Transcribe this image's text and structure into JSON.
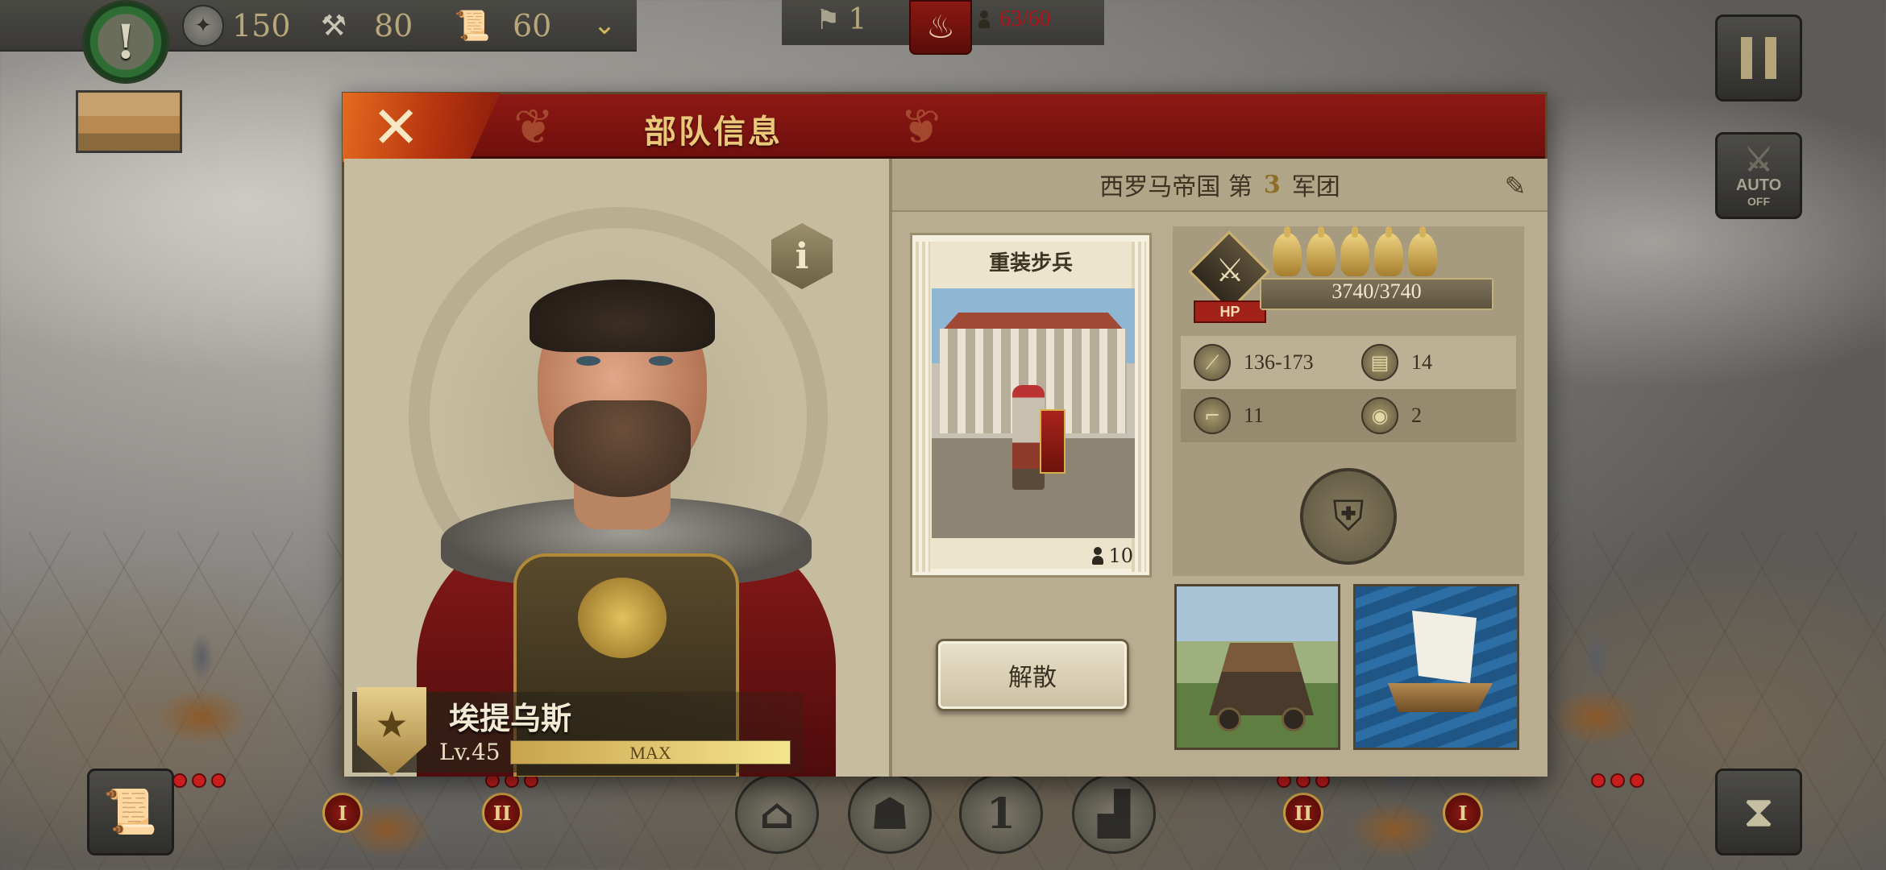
{
  "hud": {
    "alert_mark": "!",
    "resources": [
      {
        "icon": "denarius-coin-icon",
        "value": "150"
      },
      {
        "icon": "hammer-icon",
        "value": "80"
      },
      {
        "icon": "scroll-icon",
        "value": "60"
      }
    ],
    "generals": {
      "icon": "general-flag-icon",
      "value": "1"
    },
    "population": {
      "value": "63/60",
      "color": "#b2141a"
    },
    "auto": {
      "label": "AUTO",
      "state": "OFF"
    }
  },
  "dialog": {
    "title": "部队信息",
    "legion": {
      "prefix": "西罗马帝国 第",
      "number": "3",
      "suffix": "军团"
    },
    "commander": {
      "name": "埃提乌斯",
      "level": "Lv.45",
      "xp_label": "MAX",
      "xp_fraction": 1.0
    },
    "unit": {
      "name": "重装步兵",
      "count": "10",
      "stars": 5,
      "hp_label": "HP",
      "hp_text": "3740/3740",
      "hp_fraction": 1.0,
      "stats": [
        {
          "icon": "attack-icon",
          "value": "136-173"
        },
        {
          "icon": "armor-icon",
          "value": "14"
        },
        {
          "icon": "movement-boot-icon",
          "value": "11"
        },
        {
          "icon": "vision-eye-icon",
          "value": "2"
        }
      ],
      "formation_icon": "shield-wall-formation-icon"
    },
    "disband_label": "解散",
    "attachments": [
      {
        "name": "siege-engine",
        "icon": "siege-engine-icon"
      },
      {
        "name": "transport-ship",
        "icon": "ship-icon"
      }
    ]
  },
  "colors": {
    "header_red": "#8e1814",
    "panel_parchment": "#c9bfa3",
    "gold": "#e9c879"
  }
}
